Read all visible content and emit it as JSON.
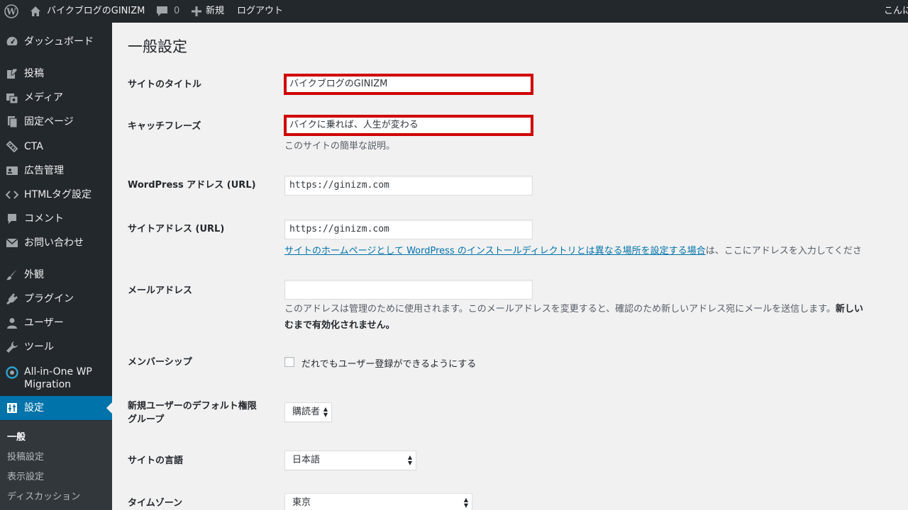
{
  "admin_bar": {
    "site_name": "バイクブログのGINIZM",
    "comments_count": "0",
    "new_label": "新規",
    "logout_label": "ログアウト",
    "greeting": "こんに"
  },
  "sidebar": {
    "items": [
      {
        "label": "ダッシュボード",
        "icon": "dashboard-icon"
      },
      {
        "label": "投稿",
        "icon": "pin-icon"
      },
      {
        "label": "メディア",
        "icon": "media-icon"
      },
      {
        "label": "固定ページ",
        "icon": "page-icon"
      },
      {
        "label": "CTA",
        "icon": "tag-icon"
      },
      {
        "label": "広告管理",
        "icon": "ad-icon"
      },
      {
        "label": "HTMLタグ設定",
        "icon": "code-icon"
      },
      {
        "label": "コメント",
        "icon": "comment-icon"
      },
      {
        "label": "お問い合わせ",
        "icon": "mail-icon"
      },
      {
        "label": "外観",
        "icon": "brush-icon"
      },
      {
        "label": "プラグイン",
        "icon": "plugin-icon"
      },
      {
        "label": "ユーザー",
        "icon": "user-icon"
      },
      {
        "label": "ツール",
        "icon": "wrench-icon"
      },
      {
        "label": "All-in-One WP",
        "label2": "Migration",
        "icon": "migration-icon"
      },
      {
        "label": "設定",
        "icon": "settings-icon"
      }
    ],
    "submenu": [
      "一般",
      "投稿設定",
      "表示設定",
      "ディスカッション"
    ]
  },
  "main": {
    "title": "一般設定",
    "site_title": {
      "label": "サイトのタイトル",
      "value": "バイクブログのGINIZM"
    },
    "tagline": {
      "label": "キャッチフレーズ",
      "value": "バイクに乗れば、人生が変わる",
      "description": "このサイトの簡単な説明。"
    },
    "wp_address": {
      "label": "WordPress アドレス (URL)",
      "value": "https://ginizm.com"
    },
    "site_address": {
      "label": "サイトアドレス (URL)",
      "value": "https://ginizm.com",
      "link_text": "サイトのホームページとして WordPress のインストールディレクトリとは異なる場所を設定する場合",
      "description_rest": "は、ここにアドレスを入力してくださ"
    },
    "email": {
      "label": "メールアドレス",
      "value": "",
      "description_line1": "このアドレスは管理のために使用されます。このメールアドレスを変更すると、確認のため新しいアドレス宛にメールを送信します。",
      "description_bold1": "新しい",
      "description_bold2": "むまで有効化されません。"
    },
    "membership": {
      "label": "メンバーシップ",
      "checkbox_label": "だれでもユーザー登録ができるようにする",
      "checked": false
    },
    "default_role": {
      "label_line1": "新規ユーザーのデフォルト権限",
      "label_line2": "グループ",
      "value": "購読者"
    },
    "language": {
      "label": "サイトの言語",
      "value": "日本語"
    },
    "timezone": {
      "label": "タイムゾーン",
      "value": "東京"
    },
    "highlight_color": "#d00000",
    "accent_color": "#0073aa"
  }
}
